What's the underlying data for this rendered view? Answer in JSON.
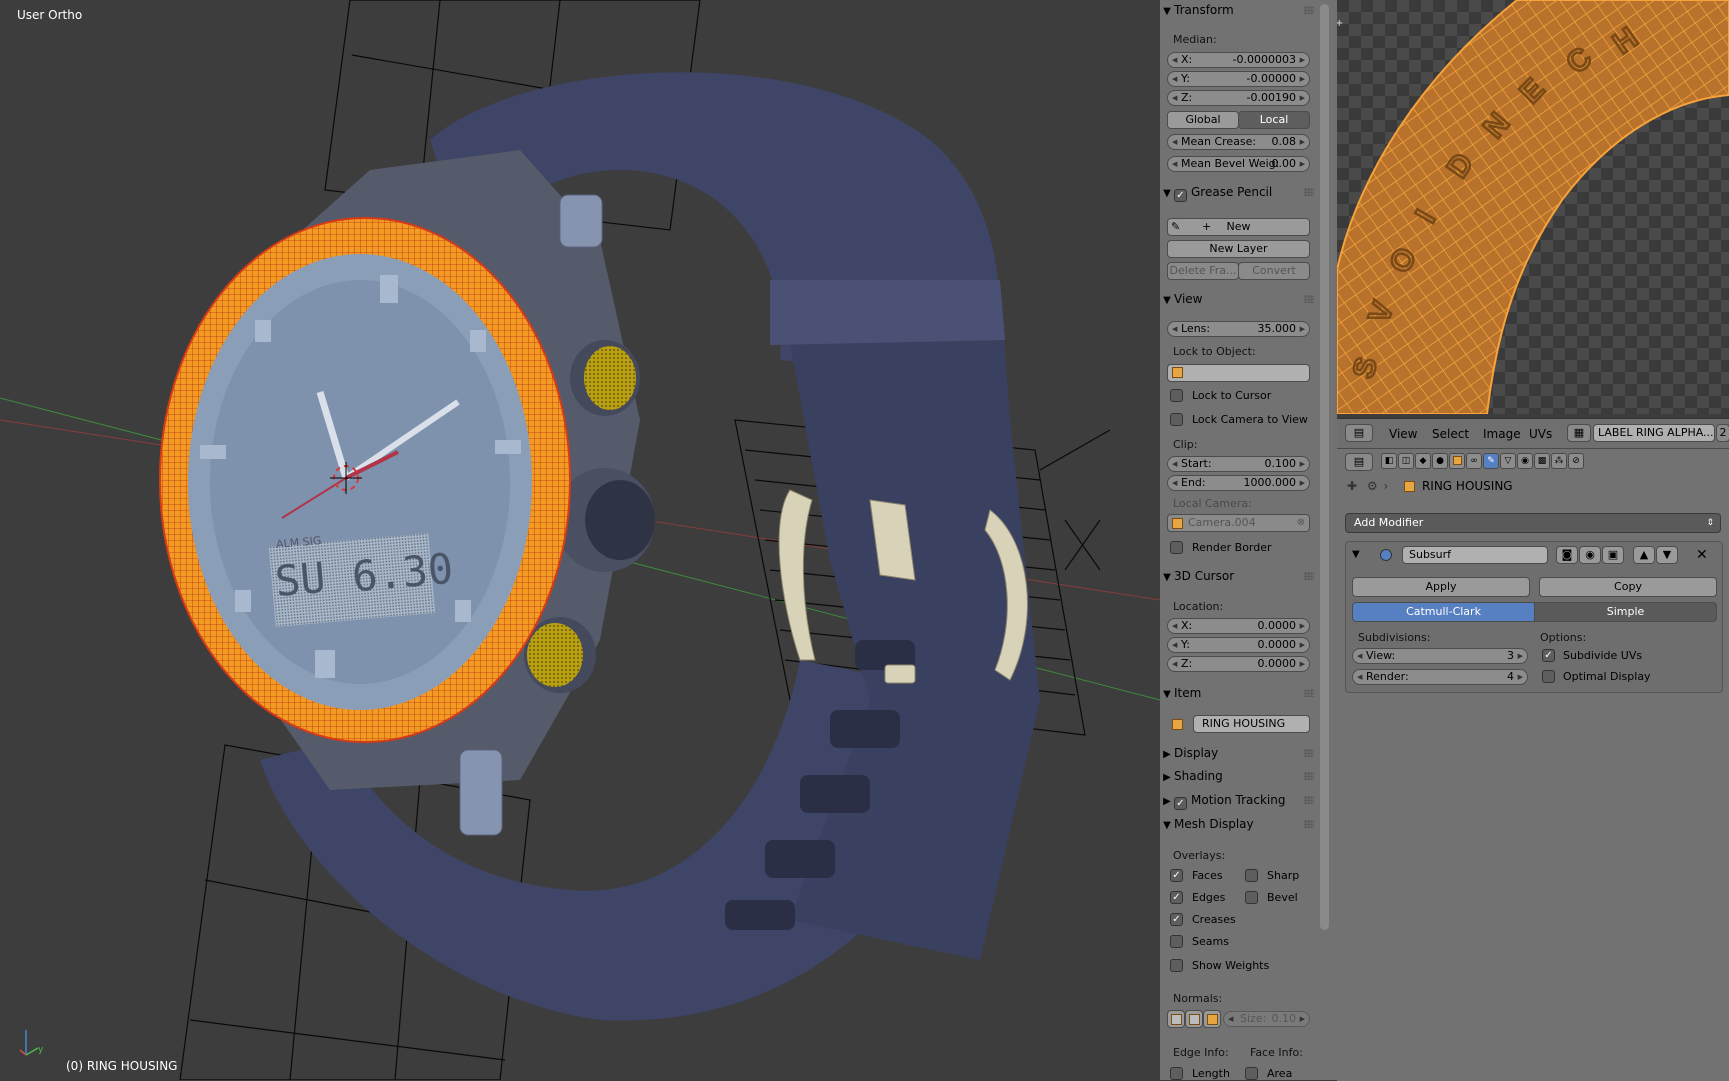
{
  "viewport": {
    "view_name": "User Ortho",
    "object_status": "(0) RING HOUSING",
    "watch_digital_top": "ALM SIG",
    "watch_digital_left": "SU",
    "watch_digital_right": "6.30",
    "axis_y_label": "y"
  },
  "npanel": {
    "transform": {
      "title": "Transform",
      "median_label": "Median:",
      "x_label": "X:",
      "x_value": "-0.0000003",
      "y_label": "Y:",
      "y_value": "-0.00000",
      "z_label": "Z:",
      "z_value": "-0.00190",
      "global_label": "Global",
      "local_label": "Local",
      "mean_crease_label": "Mean Crease:",
      "mean_crease_value": "0.08",
      "mean_bevel_label": "Mean Bevel Weig:",
      "mean_bevel_value": "0.00"
    },
    "grease_pencil": {
      "title": "Grease Pencil",
      "new_label": "New",
      "new_layer_label": "New Layer",
      "delete_frame_label": "Delete Fra...",
      "convert_label": "Convert"
    },
    "view": {
      "title": "View",
      "lens_label": "Lens:",
      "lens_value": "35.000",
      "lock_object_label": "Lock to Object:",
      "lock_cursor_label": "Lock to Cursor",
      "lock_camera_label": "Lock Camera to View",
      "clip_label": "Clip:",
      "start_label": "Start:",
      "start_value": "0.100",
      "end_label": "End:",
      "end_value": "1000.000",
      "local_camera_label": "Local Camera:",
      "camera_value": "Camera.004",
      "render_border_label": "Render Border"
    },
    "cursor": {
      "title": "3D Cursor",
      "location_label": "Location:",
      "x_label": "X:",
      "x_value": "0.0000",
      "y_label": "Y:",
      "y_value": "0.0000",
      "z_label": "Z:",
      "z_value": "0.0000"
    },
    "item": {
      "title": "Item",
      "name": "RING HOUSING"
    },
    "display_title": "Display",
    "shading_title": "Shading",
    "motion_tracking_title": "Motion Tracking",
    "mesh_display": {
      "title": "Mesh Display",
      "overlays_label": "Overlays:",
      "faces_label": "Faces",
      "sharp_label": "Sharp",
      "edges_label": "Edges",
      "bevel_label": "Bevel",
      "creases_label": "Creases",
      "seams_label": "Seams",
      "show_weights_label": "Show Weights",
      "normals_label": "Normals:",
      "size_label": "Size:",
      "size_value": "0.10",
      "edge_info_label": "Edge Info:",
      "face_info_label": "Face Info:",
      "length_label": "Length",
      "area_label": "Area"
    }
  },
  "uv_editor": {
    "menu_view": "View",
    "menu_select": "Select",
    "menu_image": "Image",
    "menu_uvs": "UVs",
    "image_name": "LABEL RING ALPHA...",
    "user_count": "2",
    "texture_letters": [
      "E",
      "N",
      "D",
      "I",
      "O",
      "V",
      "S",
      "C",
      "H"
    ]
  },
  "properties": {
    "object_name": "RING HOUSING",
    "add_modifier_label": "Add Modifier",
    "modifier_name": "Subsurf",
    "apply_label": "Apply",
    "copy_label": "Copy",
    "catmull_label": "Catmull-Clark",
    "simple_label": "Simple",
    "subdivisions_label": "Subdivisions:",
    "view_label": "View:",
    "view_value": "3",
    "render_label": "Render:",
    "render_value": "4",
    "options_label": "Options:",
    "subdivide_uvs_label": "Subdivide UVs",
    "optimal_display_label": "Optimal Display"
  },
  "colors": {
    "viewport_bg": "#3d3d3d",
    "panel_bg": "#727272",
    "accent_blue": "#5680c2",
    "selection_orange": "#f0901e",
    "strap_color": "#3e4566"
  }
}
